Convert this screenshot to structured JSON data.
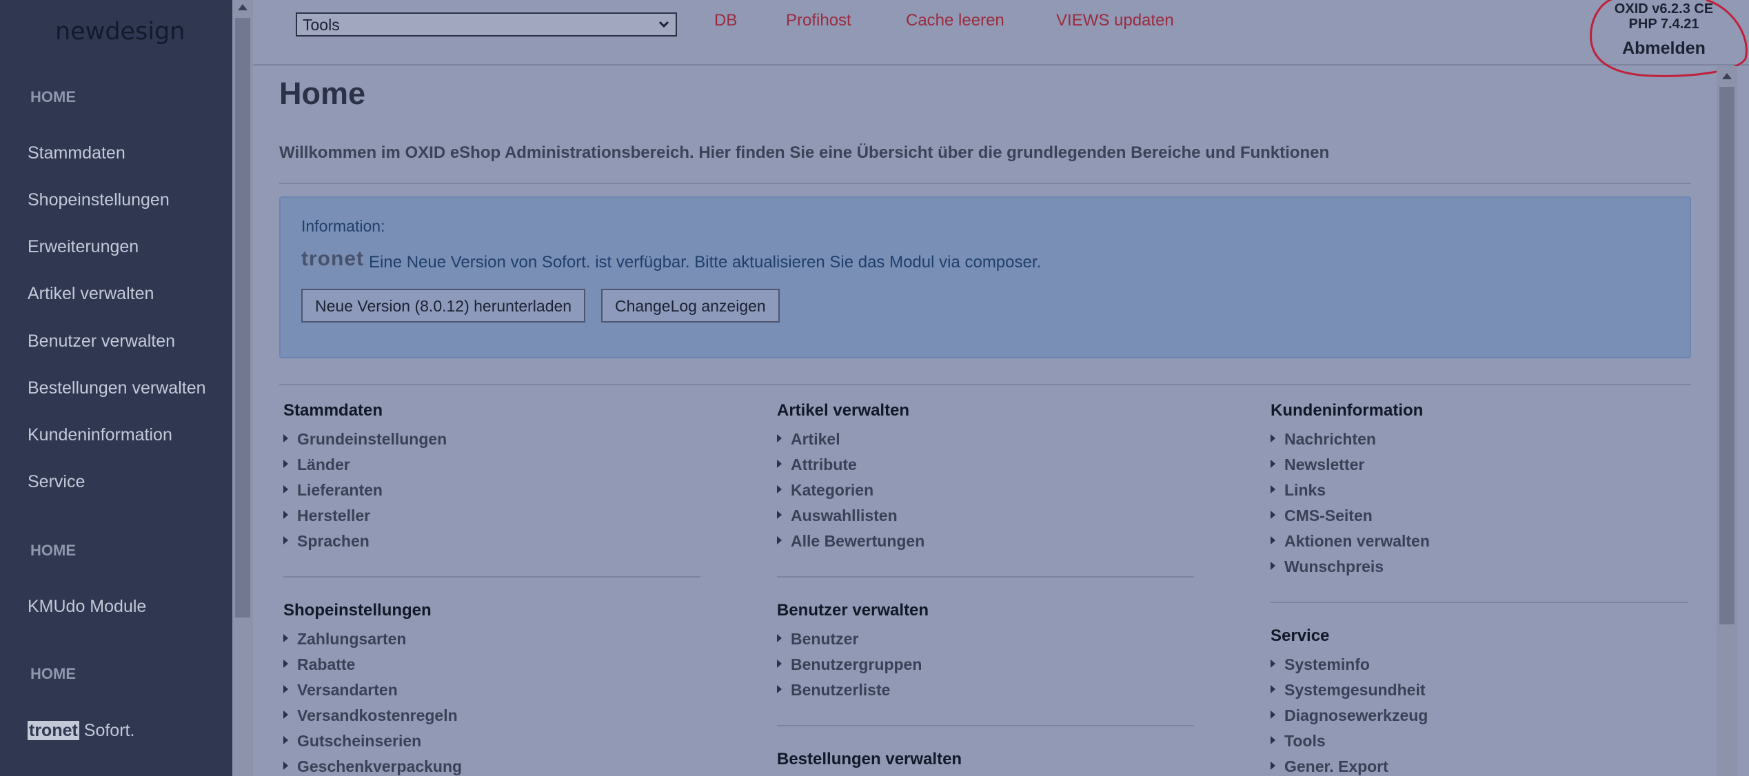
{
  "sidebar": {
    "brand": "newdesign",
    "groups": [
      {
        "heading": "HOME",
        "items": [
          "Stammdaten",
          "Shopeinstellungen",
          "Erweiterungen",
          "Artikel verwalten",
          "Benutzer verwalten",
          "Bestellungen verwalten",
          "Kundeninformation",
          "Service"
        ]
      },
      {
        "heading": "HOME",
        "items": [
          "KMUdo Module"
        ]
      },
      {
        "heading": "HOME",
        "items": []
      }
    ],
    "tronet_item": {
      "logo": "tronet",
      "label": "Sofort."
    }
  },
  "topbar": {
    "tools_select": {
      "value": "Tools"
    },
    "links": [
      "DB",
      "Profihost",
      "Cache leeren",
      "VIEWS updaten"
    ],
    "version": "OXID v6.2.3 CE",
    "php": "PHP 7.4.21",
    "logout": "Abmelden"
  },
  "main": {
    "title": "Home",
    "intro": "Willkommen im OXID eShop Administrationsbereich. Hier finden Sie eine Übersicht über die grundlegenden Bereiche und Funktionen",
    "info": {
      "label": "Information:",
      "logo": "tronet",
      "text": "Eine Neue Version von Sofort. ist verfügbar. Bitte aktualisieren Sie das Modul via composer.",
      "download_button": "Neue Version (8.0.12) herunterladen",
      "changelog_button": "ChangeLog anzeigen"
    },
    "columns": [
      [
        {
          "title": "Stammdaten",
          "items": [
            "Grundeinstellungen",
            "Länder",
            "Lieferanten",
            "Hersteller",
            "Sprachen"
          ]
        },
        {
          "title": "Shopeinstellungen",
          "items": [
            "Zahlungsarten",
            "Rabatte",
            "Versandarten",
            "Versandkostenregeln",
            "Gutscheinserien",
            "Geschenkverpackung"
          ]
        }
      ],
      [
        {
          "title": "Artikel verwalten",
          "items": [
            "Artikel",
            "Attribute",
            "Kategorien",
            "Auswahllisten",
            "Alle Bewertungen"
          ]
        },
        {
          "title": "Benutzer verwalten",
          "items": [
            "Benutzer",
            "Benutzergruppen",
            "Benutzerliste"
          ]
        },
        {
          "title": "Bestellungen verwalten",
          "items": []
        }
      ],
      [
        {
          "title": "Kundeninformation",
          "items": [
            "Nachrichten",
            "Newsletter",
            "Links",
            "CMS-Seiten",
            "Aktionen verwalten",
            "Wunschpreis"
          ]
        },
        {
          "title": "Service",
          "items": [
            "Systeminfo",
            "Systemgesundheit",
            "Diagnosewerkzeug",
            "Tools",
            "Gener. Export"
          ]
        }
      ]
    ]
  },
  "colors": {
    "overlay_bg": "#9199b5",
    "sidebar_bg": "#2f3751",
    "link_red": "#9a2c3e",
    "info_bg": "#7a8fb5",
    "annotation_red": "#c0203a"
  }
}
